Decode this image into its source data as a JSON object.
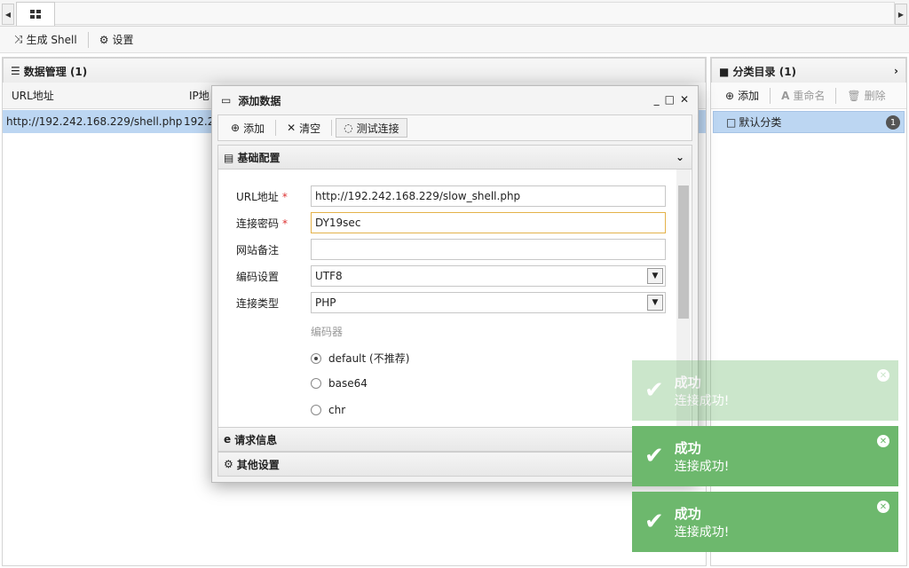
{
  "toolbar": {
    "generate_shell": "生成 Shell",
    "settings": "设置"
  },
  "data_panel": {
    "title": "数据管理 (1)",
    "columns": [
      "URL地址",
      "IP地"
    ],
    "rows": [
      {
        "url": "http://192.242.168.229/shell.php",
        "ip": "192.2"
      }
    ]
  },
  "category_panel": {
    "title": "分类目录 (1)",
    "add": "添加",
    "rename": "重命名",
    "delete": "删除",
    "items": [
      {
        "name": "默认分类",
        "count": "1"
      }
    ]
  },
  "dialog": {
    "title": "添加数据",
    "btn_add": "添加",
    "btn_clear": "清空",
    "btn_test": "测试连接",
    "section_basic": "基础配置",
    "section_request": "请求信息",
    "section_other": "其他设置",
    "labels": {
      "url": "URL地址",
      "password": "连接密码",
      "note": "网站备注",
      "encoding": "编码设置",
      "type": "连接类型",
      "encoder": "编码器"
    },
    "values": {
      "url": "http://192.242.168.229/slow_shell.php",
      "password": "DY19sec",
      "note": "",
      "encoding": "UTF8",
      "type": "PHP"
    },
    "encoders": [
      {
        "label": "default (不推荐)",
        "checked": true
      },
      {
        "label": "base64",
        "checked": false
      },
      {
        "label": "chr",
        "checked": false
      }
    ]
  },
  "toasts": [
    {
      "title": "成功",
      "message": "连接成功!",
      "faded": true
    },
    {
      "title": "成功",
      "message": "连接成功!",
      "faded": false
    },
    {
      "title": "成功",
      "message": "连接成功!",
      "faded": false
    }
  ],
  "colors": {
    "toast": "#6db86d",
    "selected_row": "#bcd6f2"
  }
}
